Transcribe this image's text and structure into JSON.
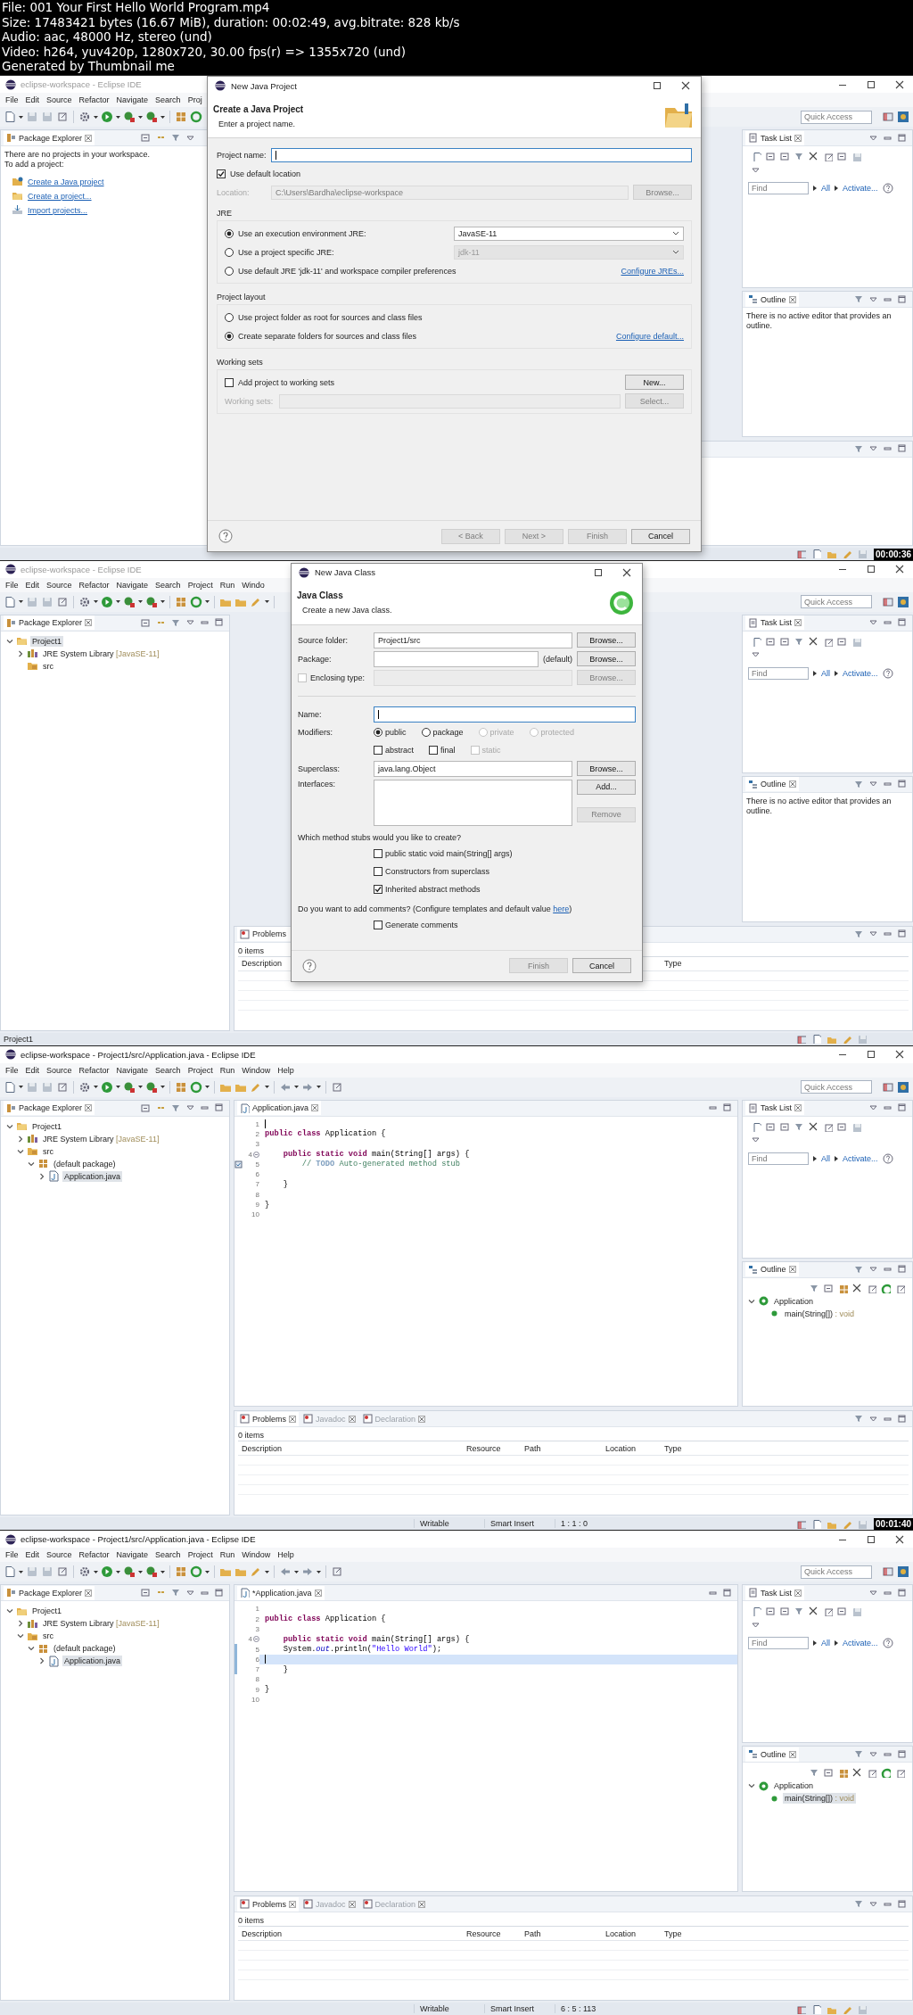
{
  "header": {
    "lines": [
      "File: 001 Your First Hello World Program.mp4",
      "Size: 17483421 bytes (16.67 MiB), duration: 00:02:49, avg.bitrate: 828 kb/s",
      "Audio: aac, 48000 Hz, stereo (und)",
      "Video: h264, yuv420p, 1280x720, 30.00 fps(r) => 1355x720 (und)",
      "Generated by Thumbnail me"
    ]
  },
  "frames": [
    {
      "active": false,
      "window_title": "eclipse-workspace - Eclipse IDE",
      "menu": [
        "File",
        "Edit",
        "Source",
        "Refactor",
        "Navigate",
        "Search",
        "Proj"
      ],
      "quick_access": {
        "placeholder": "Quick Access"
      },
      "package_explorer": {
        "title": "Package Explorer",
        "messages": [
          "There are no projects in your workspace.",
          "To add a project:"
        ],
        "links": [
          {
            "kind": "java-project",
            "label": "Create a Java project"
          },
          {
            "kind": "project",
            "label": "Create a project..."
          },
          {
            "kind": "import",
            "label": "Import projects..."
          }
        ]
      },
      "task_list": {
        "title": "Task List",
        "find": {
          "placeholder": "Find"
        },
        "filters": [
          "All",
          "Activate..."
        ]
      },
      "outline": {
        "title": "Outline",
        "message": "There is no active editor that provides an outline."
      },
      "timestamp": "00:00:36",
      "dialog": {
        "kind": "project",
        "title": "New Java Project",
        "heading": "Create a Java Project",
        "subheading": "Enter a project name.",
        "rows": [
          {
            "kind": "field",
            "label": "Project name:",
            "focused": true,
            "disabled": false
          },
          {
            "kind": "check",
            "label": "Use default location",
            "checked": true
          },
          {
            "kind": "field",
            "label": "Location:",
            "value": "C:\\Users\\Bardha\\eclipse-workspace",
            "focused": false,
            "disabled": true,
            "button": {
              "label": "Browse...",
              "disabled": true
            }
          },
          {
            "kind": "group",
            "title": "JRE",
            "rows": [
              {
                "kind": "radio",
                "label": "Use an execution environment JRE:",
                "selected": true,
                "select": {
                  "value": "JavaSE-11",
                  "disabled": false
                }
              },
              {
                "kind": "radio",
                "label": "Use a project specific JRE:",
                "selected": false,
                "select": {
                  "value": "jdk-11",
                  "disabled": true
                }
              },
              {
                "kind": "radio",
                "label": "Use default JRE 'jdk-11' and workspace compiler preferences",
                "selected": false,
                "link": "Configure JREs..."
              }
            ]
          },
          {
            "kind": "group",
            "title": "Project layout",
            "rows": [
              {
                "kind": "radio",
                "label": "Use project folder as root for sources and class files",
                "selected": false
              },
              {
                "kind": "radio",
                "label": "Create separate folders for sources and class files",
                "selected": true,
                "link": "Configure default..."
              }
            ]
          },
          {
            "kind": "group",
            "title": "Working sets",
            "rows": [
              {
                "kind": "check",
                "label": "Add project to working sets",
                "checked": false,
                "button": {
                  "label": "New...",
                  "disabled": false
                }
              },
              {
                "kind": "field",
                "label": "Working sets:",
                "focused": false,
                "disabled": true,
                "button": {
                  "label": "Select...",
                  "disabled": true
                }
              }
            ]
          }
        ],
        "buttons": [
          {
            "label": "< Back",
            "disabled": true
          },
          {
            "label": "Next >",
            "disabled": true
          },
          {
            "label": "Finish",
            "disabled": true
          },
          {
            "label": "Cancel",
            "disabled": false
          }
        ]
      }
    },
    {
      "active": false,
      "window_title": "eclipse-workspace - Eclipse IDE",
      "menu": [
        "File",
        "Edit",
        "Source",
        "Refactor",
        "Navigate",
        "Search",
        "Project",
        "Run",
        "Windo"
      ],
      "quick_access": {
        "placeholder": "Quick Access"
      },
      "package_explorer": {
        "title": "Package Explorer",
        "tree": [
          {
            "kind": "project",
            "label": "Project1",
            "expandable": true,
            "expanded": true,
            "selected": true,
            "children": [
              {
                "kind": "library",
                "label": "JRE System Library",
                "detail": " [JavaSE-11]",
                "expandable": true,
                "expanded": false,
                "selected": false
              },
              {
                "kind": "source-folder",
                "label": "src",
                "expandable": false,
                "selected": false
              }
            ]
          }
        ]
      },
      "task_list": {
        "title": "Task List",
        "find": {
          "placeholder": "Find"
        },
        "filters": [
          "All",
          "Activate..."
        ]
      },
      "outline": {
        "title": "Outline",
        "message": "There is no active editor that provides an outline."
      },
      "problems": {
        "tabs": [
          {
            "label": "Problems",
            "selected": true
          }
        ],
        "count": "0 items",
        "columns": [
          "Description",
          "Type"
        ]
      },
      "status": {
        "message": "Project1"
      },
      "dialog": {
        "kind": "class",
        "title": "New Java Class",
        "heading": "Java Class",
        "subheading": "Create a new Java class.",
        "rows": [
          {
            "kind": "field",
            "label": "Source folder:",
            "value": "Project1/src",
            "focused": false,
            "disabled": false,
            "button": {
              "label": "Browse...",
              "disabled": false
            }
          },
          {
            "kind": "field",
            "label": "Package:",
            "focused": false,
            "disabled": false,
            "suffix": "(default)",
            "button": {
              "label": "Browse...",
              "disabled": false
            }
          },
          {
            "kind": "check-field",
            "label": "Enclosing type:",
            "checked": false,
            "disabled": true,
            "button": {
              "label": "Browse...",
              "disabled": true
            }
          },
          {
            "kind": "separator"
          },
          {
            "kind": "field",
            "label": "Name:",
            "focused": true,
            "disabled": false
          },
          {
            "kind": "radios",
            "label": "Modifiers:",
            "options": [
              {
                "label": "public",
                "selected": true,
                "disabled": false
              },
              {
                "label": "package",
                "selected": false,
                "disabled": false
              },
              {
                "label": "private",
                "selected": false,
                "disabled": true
              },
              {
                "label": "protected",
                "selected": false,
                "disabled": true
              }
            ]
          },
          {
            "kind": "checks",
            "options": [
              {
                "label": "abstract",
                "checked": false,
                "disabled": false
              },
              {
                "label": "final",
                "checked": false,
                "disabled": false
              },
              {
                "label": "static",
                "checked": false,
                "disabled": true
              }
            ]
          },
          {
            "kind": "field",
            "label": "Superclass:",
            "value": "java.lang.Object",
            "focused": false,
            "disabled": false,
            "button": {
              "label": "Browse...",
              "disabled": false
            }
          },
          {
            "kind": "list",
            "label": "Interfaces:",
            "buttons": [
              {
                "label": "Add...",
                "disabled": false
              },
              {
                "label": "Remove",
                "disabled": true
              }
            ]
          },
          {
            "kind": "text",
            "text": "Which method stubs would you like to create?"
          },
          {
            "kind": "checks",
            "options": [
              {
                "label": "public static void main(String[] args)",
                "checked": false,
                "disabled": false
              }
            ]
          },
          {
            "kind": "checks",
            "options": [
              {
                "label": "Constructors from superclass",
                "checked": false,
                "disabled": false
              }
            ]
          },
          {
            "kind": "checks",
            "options": [
              {
                "label": "Inherited abstract methods",
                "checked": true,
                "disabled": false
              }
            ]
          },
          {
            "kind": "text",
            "text": "Do you want to add comments? (Configure templates and default value ",
            "link": "here",
            "after": ")"
          },
          {
            "kind": "checks",
            "options": [
              {
                "label": "Generate comments",
                "checked": false,
                "disabled": false
              }
            ]
          }
        ],
        "buttons": [
          {
            "label": "Finish",
            "disabled": true
          },
          {
            "label": "Cancel",
            "disabled": false
          }
        ]
      }
    },
    {
      "active": true,
      "window_title": "eclipse-workspace - Project1/src/Application.java - Eclipse IDE",
      "menu": [
        "File",
        "Edit",
        "Source",
        "Refactor",
        "Navigate",
        "Search",
        "Project",
        "Run",
        "Window",
        "Help"
      ],
      "quick_access": {
        "placeholder": "Quick Access"
      },
      "package_explorer": {
        "title": "Package Explorer",
        "tree": [
          {
            "kind": "project",
            "label": "Project1",
            "expandable": true,
            "expanded": true,
            "selected": false,
            "children": [
              {
                "kind": "library",
                "label": "JRE System Library",
                "detail": " [JavaSE-11]",
                "expandable": true,
                "expanded": false,
                "selected": false
              },
              {
                "kind": "source-folder",
                "label": "src",
                "expandable": true,
                "expanded": true,
                "selected": false,
                "children": [
                  {
                    "kind": "package",
                    "label": "(default package)",
                    "expandable": true,
                    "expanded": true,
                    "selected": false,
                    "children": [
                      {
                        "kind": "file",
                        "label": "Application.java",
                        "expandable": true,
                        "expanded": false,
                        "selected": true
                      }
                    ]
                  }
                ]
              }
            ]
          }
        ]
      },
      "editor": {
        "tab": "Application.java",
        "lines": [
          {
            "number": "1",
            "current": false,
            "changed": false,
            "caret": true
          },
          {
            "number": "2",
            "current": false,
            "changed": false,
            "tokens": [
              {
                "kind": "keyword",
                "text": "public "
              },
              {
                "kind": "keyword",
                "text": "class"
              },
              {
                "kind": "plain",
                "text": " Application {"
              }
            ]
          },
          {
            "number": "3",
            "current": false,
            "changed": false
          },
          {
            "number": "4",
            "current": false,
            "changed": false,
            "fold": true,
            "tokens": [
              {
                "kind": "keyword",
                "text": "    public static void"
              },
              {
                "kind": "plain",
                "text": " main(String[] args) {"
              }
            ]
          },
          {
            "number": "5",
            "current": false,
            "changed": false,
            "annotation": true,
            "tokens": [
              {
                "kind": "comment",
                "text": "        // "
              },
              {
                "kind": "todo",
                "text": "TODO"
              },
              {
                "kind": "comment",
                "text": " Auto-generated method stub"
              }
            ]
          },
          {
            "number": "6",
            "current": false,
            "changed": false
          },
          {
            "number": "7",
            "current": false,
            "changed": false,
            "tokens": [
              {
                "kind": "plain",
                "text": "    }"
              }
            ]
          },
          {
            "number": "8",
            "current": false,
            "changed": false
          },
          {
            "number": "9",
            "current": false,
            "changed": false,
            "tokens": [
              {
                "kind": "plain",
                "text": "}"
              }
            ]
          },
          {
            "number": "10",
            "current": false,
            "changed": false
          }
        ]
      },
      "task_list": {
        "title": "Task List",
        "find": {
          "placeholder": "Find"
        },
        "filters": [
          "All",
          "Activate..."
        ]
      },
      "outline": {
        "title": "Outline",
        "tree": [
          {
            "kind": "class",
            "label": "Application",
            "expandable": true,
            "expanded": true,
            "selected": false,
            "children": [
              {
                "kind": "method",
                "label": "main(String[])",
                "detail": " : void",
                "expandable": false,
                "selected": false
              }
            ]
          }
        ]
      },
      "problems": {
        "tabs": [
          {
            "label": "Problems",
            "selected": true
          },
          {
            "label": "Javadoc",
            "selected": false
          },
          {
            "label": "Declaration",
            "selected": false
          }
        ],
        "count": "0 items",
        "columns": [
          "Description",
          "Resource",
          "Path",
          "Location",
          "Type"
        ]
      },
      "status": {
        "fields": [
          "Writable",
          "Smart Insert",
          "1 : 1 : 0"
        ]
      },
      "timestamp": "00:01:40"
    },
    {
      "active": true,
      "window_title": "eclipse-workspace - Project1/src/Application.java - Eclipse IDE",
      "menu": [
        "File",
        "Edit",
        "Source",
        "Refactor",
        "Navigate",
        "Search",
        "Project",
        "Run",
        "Window",
        "Help"
      ],
      "quick_access": {
        "placeholder": "Quick Access"
      },
      "package_explorer": {
        "title": "Package Explorer",
        "tree": [
          {
            "kind": "project",
            "label": "Project1",
            "expandable": true,
            "expanded": true,
            "selected": false,
            "children": [
              {
                "kind": "library",
                "label": "JRE System Library",
                "detail": " [JavaSE-11]",
                "expandable": true,
                "expanded": false,
                "selected": false
              },
              {
                "kind": "source-folder",
                "label": "src",
                "expandable": true,
                "expanded": true,
                "selected": false,
                "children": [
                  {
                    "kind": "package",
                    "label": "(default package)",
                    "expandable": true,
                    "expanded": true,
                    "selected": false,
                    "children": [
                      {
                        "kind": "file",
                        "label": "Application.java",
                        "expandable": true,
                        "expanded": false,
                        "selected": true
                      }
                    ]
                  }
                ]
              }
            ]
          }
        ]
      },
      "editor": {
        "tab": "*Application.java",
        "lines": [
          {
            "number": "1",
            "current": false,
            "changed": false
          },
          {
            "number": "2",
            "current": false,
            "changed": false,
            "tokens": [
              {
                "kind": "keyword",
                "text": "public "
              },
              {
                "kind": "keyword",
                "text": "class"
              },
              {
                "kind": "plain",
                "text": " Application {"
              }
            ]
          },
          {
            "number": "3",
            "current": false,
            "changed": false
          },
          {
            "number": "4",
            "current": false,
            "changed": false,
            "fold": true,
            "tokens": [
              {
                "kind": "keyword",
                "text": "    public static void"
              },
              {
                "kind": "plain",
                "text": " main(String[] args) {"
              }
            ]
          },
          {
            "number": "5",
            "current": false,
            "changed": true,
            "tokens": [
              {
                "kind": "plain",
                "text": "    System."
              },
              {
                "kind": "field",
                "text": "out"
              },
              {
                "kind": "plain",
                "text": ".println("
              },
              {
                "kind": "string",
                "text": "\"Hello World\""
              },
              {
                "kind": "plain",
                "text": ");"
              }
            ]
          },
          {
            "number": "6",
            "current": true,
            "changed": true,
            "caret": true
          },
          {
            "number": "7",
            "current": false,
            "changed": true,
            "tokens": [
              {
                "kind": "plain",
                "text": "    }"
              }
            ]
          },
          {
            "number": "8",
            "current": false,
            "changed": false
          },
          {
            "number": "9",
            "current": false,
            "changed": false,
            "tokens": [
              {
                "kind": "plain",
                "text": "}"
              }
            ]
          },
          {
            "number": "10",
            "current": false,
            "changed": false
          }
        ]
      },
      "task_list": {
        "title": "Task List",
        "find": {
          "placeholder": "Find"
        },
        "filters": [
          "All",
          "Activate..."
        ]
      },
      "outline": {
        "title": "Outline",
        "tree": [
          {
            "kind": "class",
            "label": "Application",
            "expandable": true,
            "expanded": true,
            "selected": false,
            "children": [
              {
                "kind": "method",
                "label": "main(String[])",
                "detail": " : void",
                "expandable": false,
                "selected": true
              }
            ]
          }
        ]
      },
      "problems": {
        "tabs": [
          {
            "label": "Problems",
            "selected": true
          },
          {
            "label": "Javadoc",
            "selected": false
          },
          {
            "label": "Declaration",
            "selected": false
          }
        ],
        "count": "0 items",
        "columns": [
          "Description",
          "Resource",
          "Path",
          "Location",
          "Type"
        ]
      },
      "status": {
        "fields": [
          "Writable",
          "Smart Insert",
          "6 : 5 : 113"
        ]
      }
    }
  ]
}
